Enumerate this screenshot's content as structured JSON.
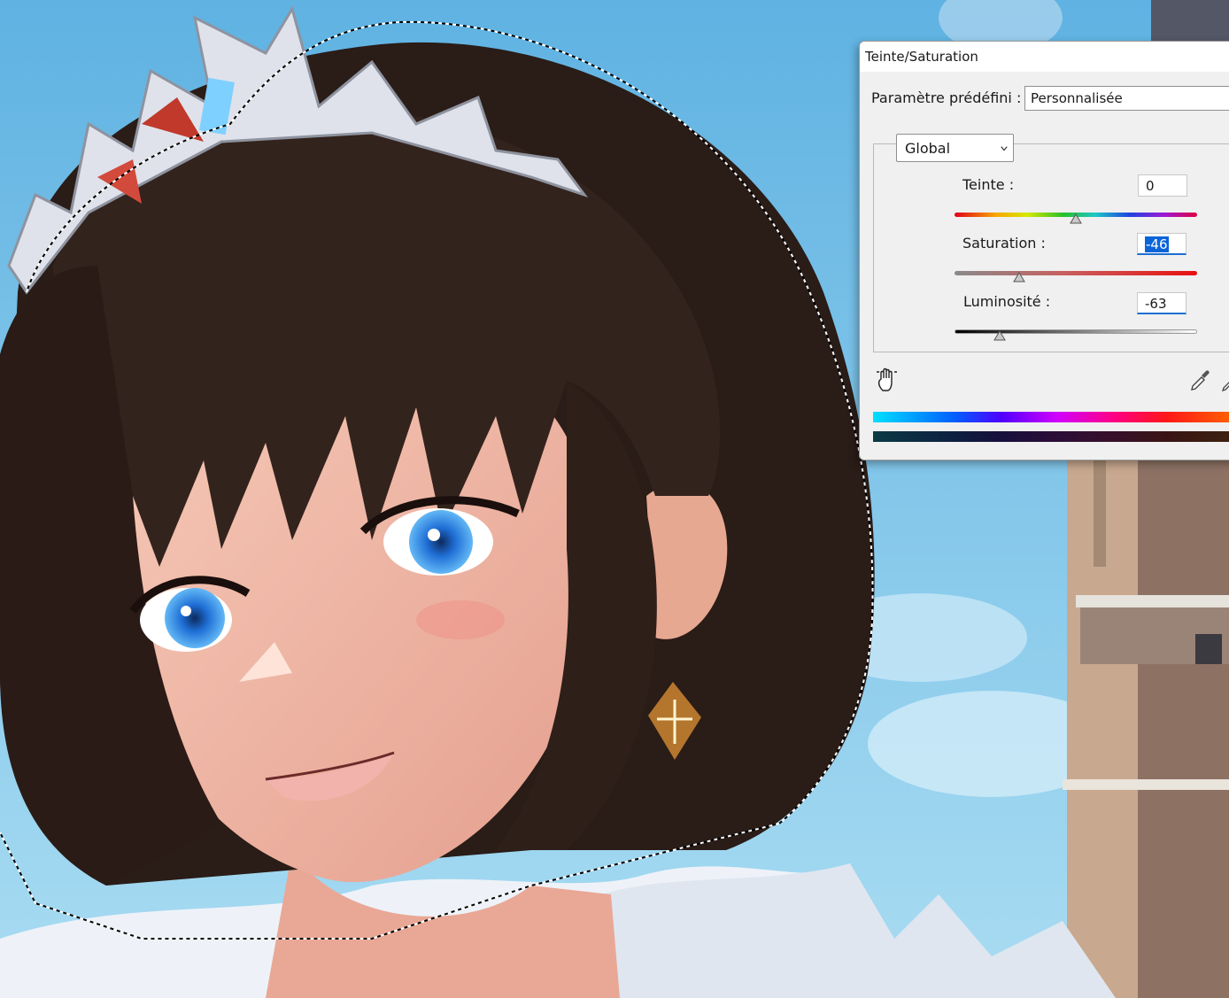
{
  "dialog": {
    "title": "Teinte/Saturation",
    "preset_label": "Paramètre prédéfini :",
    "preset_value": "Personnalisée",
    "channel_value": "Global",
    "hue": {
      "label": "Teinte :",
      "value": "0",
      "level": 0.5
    },
    "saturation": {
      "label": "Saturation :",
      "value": "-46",
      "level": 0.27
    },
    "lightness": {
      "label": "Luminosité :",
      "value": "-63",
      "level": 0.18
    },
    "icons": [
      "hand-adjust-icon",
      "eyedropper-icon",
      "eyedropper-plus-icon"
    ]
  },
  "colors": {
    "sky": "#7fc3e8",
    "hair": "#2a1c17",
    "focus_blue": "#0a64d8"
  }
}
